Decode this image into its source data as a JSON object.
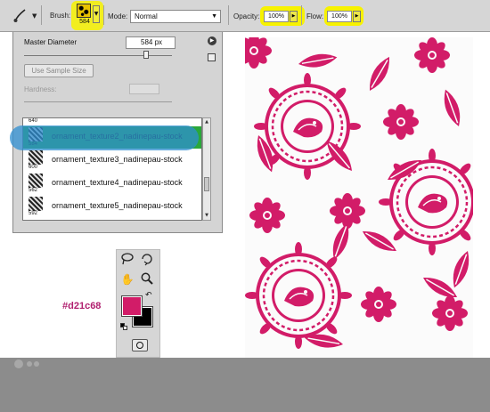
{
  "options_bar": {
    "brush_label": "Brush:",
    "brush_size": "584",
    "mode_label": "Mode:",
    "mode_value": "Normal",
    "opacity_label": "Opacity:",
    "opacity_value": "100%",
    "flow_label": "Flow:",
    "flow_value": "100%"
  },
  "brush_panel": {
    "master_diameter_label": "Master Diameter",
    "master_diameter_value": "584 px",
    "use_sample_size_label": "Use Sample Size",
    "hardness_label": "Hardness:",
    "list_top_size": "640",
    "brushes": [
      {
        "name": "ornament_texture2_nadinepau-stock",
        "size": "584",
        "selected": true
      },
      {
        "name": "ornament_texture3_nadinepau-stock",
        "size": "600",
        "selected": false
      },
      {
        "name": "ornament_texture4_nadinepau-stock",
        "size": "562",
        "selected": false
      },
      {
        "name": "ornament_texture5_nadinepau-stock",
        "size": "592",
        "selected": false
      }
    ]
  },
  "tools": {
    "foreground_color": "#d21c68",
    "background_color": "#000000"
  },
  "color_annotation": "#d21c68",
  "colors": {
    "highlight": "#f7f200",
    "selection": "#2aa83a",
    "pattern": "#d21c68"
  }
}
